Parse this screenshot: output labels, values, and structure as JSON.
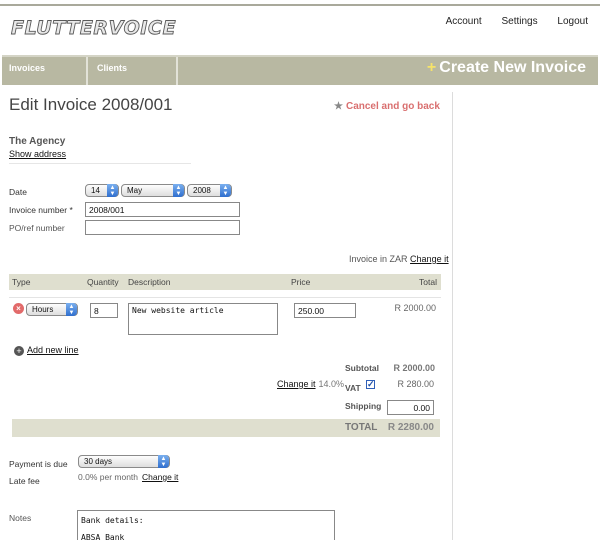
{
  "header": {
    "logo_text": "FLUTTERVOICE",
    "nav": [
      "Account",
      "Settings",
      "Logout"
    ]
  },
  "navbar": {
    "tabs": [
      "Invoices",
      "Clients"
    ],
    "create_label": "Create New Invoice"
  },
  "page": {
    "title": "Edit Invoice 2008/001",
    "cancel_label": "Cancel and go back"
  },
  "client": {
    "name": "The Agency",
    "show_address": "Show address"
  },
  "form": {
    "date_label": "Date",
    "day": "14",
    "month": "May",
    "year": "2008",
    "invoice_number_label": "Invoice number *",
    "invoice_number": "2008/001",
    "po_label": "PO/ref number",
    "po_value": ""
  },
  "currency": {
    "text": "Invoice in ZAR",
    "change": "Change it"
  },
  "table": {
    "headers": [
      "Type",
      "Quantity",
      "Description",
      "Price",
      "Total"
    ],
    "rows": [
      {
        "type": "Hours",
        "quantity": "8",
        "description": "New website article",
        "price": "250.00",
        "total": "R 2000.00"
      }
    ],
    "add_line": "Add new line"
  },
  "totals": {
    "subtotal_label": "Subtotal",
    "subtotal": "R 2000.00",
    "vat_change": "Change it",
    "vat_rate": "14.0%",
    "vat_label": "VAT",
    "vat_checked": true,
    "vat": "R 280.00",
    "shipping_label": "Shipping",
    "shipping": "0.00",
    "total_label": "TOTAL",
    "total": "R 2280.00"
  },
  "payment": {
    "due_label": "Payment is due",
    "due_value": "30 days",
    "late_fee_label": "Late fee",
    "late_fee_value": "0.0% per month",
    "late_fee_change": "Change it"
  },
  "notes": {
    "label": "Notes",
    "lines": [
      "Bank details:",
      "ABSA Bank"
    ]
  },
  "colors": {
    "navbar": "#b8b8a2",
    "table_header": "#dfdfcf",
    "cancel": "#d96f6f",
    "plus": "#f6e36a",
    "select_arrow": "#2f6fce"
  }
}
